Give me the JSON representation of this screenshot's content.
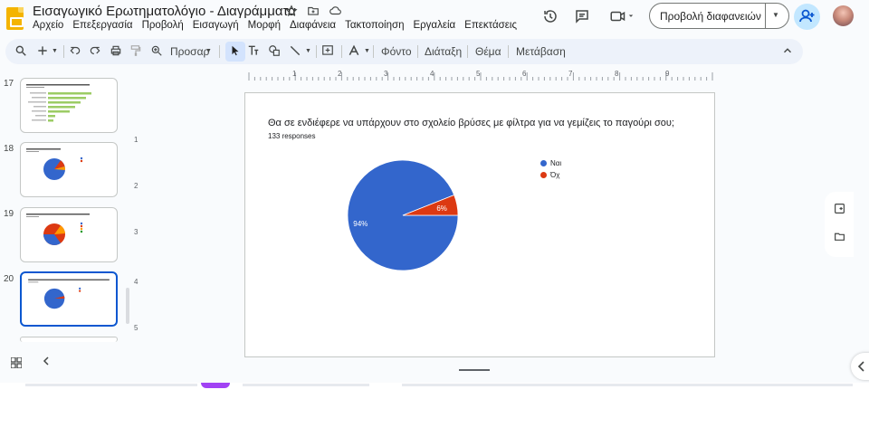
{
  "app": {
    "title": "Εισαγωγικό Ερωτηματολόγιο - Διαγράμματα",
    "menu": [
      "Αρχείο",
      "Επεξεργασία",
      "Προβολή",
      "Εισαγωγή",
      "Μορφή",
      "Διαφάνεια",
      "Τακτοποίηση",
      "Εργαλεία",
      "Επεκτάσεις"
    ],
    "present_label": "Προβολή διαφανειών"
  },
  "toolbar": {
    "zoom_label": "Προσαρ",
    "background_label": "Φόντο",
    "layout_label": "Διάταξη",
    "theme_label": "Θέμα",
    "transition_label": "Μετάβαση"
  },
  "filmstrip": {
    "slides": [
      {
        "number": "17"
      },
      {
        "number": "18"
      },
      {
        "number": "19"
      },
      {
        "number": "20"
      }
    ]
  },
  "ruler": {
    "h_labels": [
      "1",
      "2",
      "3",
      "4",
      "5",
      "6",
      "7",
      "8",
      "9"
    ],
    "v_labels": [
      "1",
      "2",
      "3",
      "4",
      "5"
    ]
  },
  "chart_data": {
    "type": "pie",
    "title": "Θα σε ενδιέφερε να υπάρχουν στο σχολείο βρύσες με φίλτρα για να γεμίζεις το παγούρι σου;",
    "subtitle": "133 responses",
    "categories": [
      "Ναι",
      "Όχι"
    ],
    "legend_labels": [
      "Ναι",
      "Όχ"
    ],
    "values": [
      94,
      6
    ],
    "value_labels": [
      "94%",
      "6%"
    ],
    "colors": [
      "#3366cc",
      "#dc3912"
    ],
    "legend_position": "right"
  }
}
